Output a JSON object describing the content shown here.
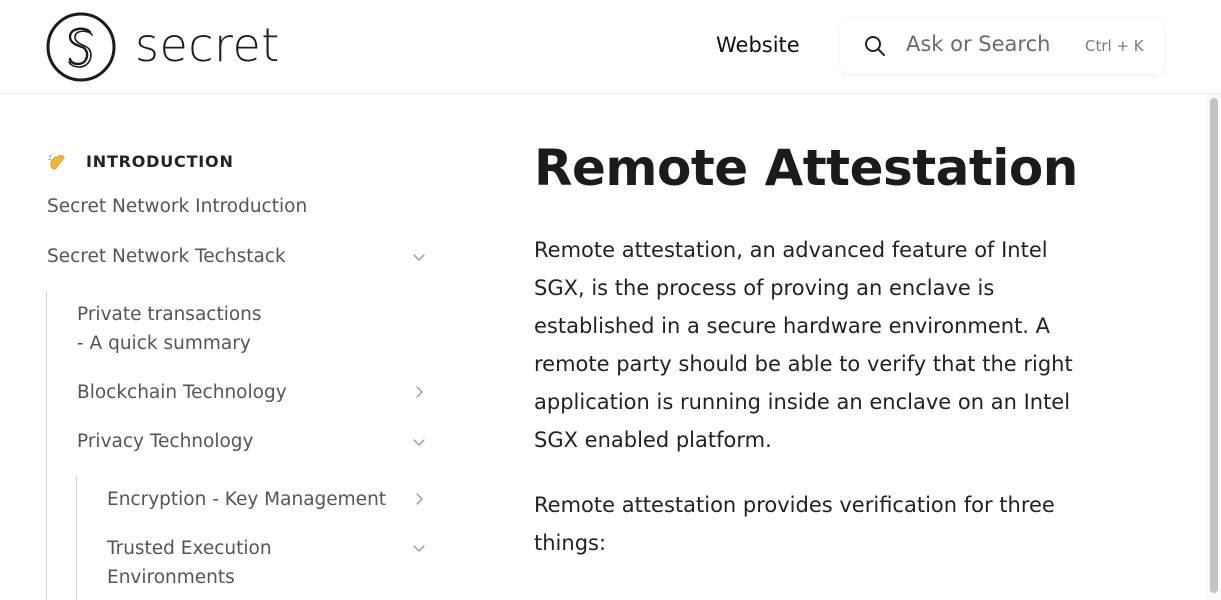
{
  "header": {
    "logo_text": "secret",
    "nav_website": "Website",
    "search_placeholder": "Ask or Search",
    "search_shortcut": "Ctrl + K"
  },
  "sidebar": {
    "section_label": "INTRODUCTION",
    "section_icon": "waving-hand-icon",
    "items": [
      {
        "label": "Secret Network Introduction",
        "chevron": "none"
      },
      {
        "label": "Secret Network Techstack",
        "chevron": "down"
      },
      {
        "label_line1": "Private transactions",
        "label_line2": "- A quick summary",
        "chevron": "none"
      },
      {
        "label": "Blockchain Technology",
        "chevron": "right"
      },
      {
        "label": "Privacy Technology",
        "chevron": "down"
      },
      {
        "label": "Encryption - Key Management",
        "chevron": "right"
      },
      {
        "label_line1": "Trusted Execution",
        "label_line2": "Environments",
        "chevron": "down"
      }
    ]
  },
  "main": {
    "title": "Remote Attestation",
    "paragraph1_lines": [
      "Remote attestation, an advanced feature of Intel",
      "SGX, is the process of proving an enclave is",
      "established in a secure hardware environment. A",
      "remote party should be able to verify that the right",
      "application is running inside an enclave on an Intel",
      "SGX enabled platform."
    ],
    "paragraph2_lines": [
      "Remote attestation provides verification for three",
      "things:"
    ]
  },
  "colors": {
    "text_primary": "#1b1b1b",
    "text_sidebar": "#555555",
    "divider": "#ececec",
    "scrollbar_thumb": "#c4c4c4"
  }
}
